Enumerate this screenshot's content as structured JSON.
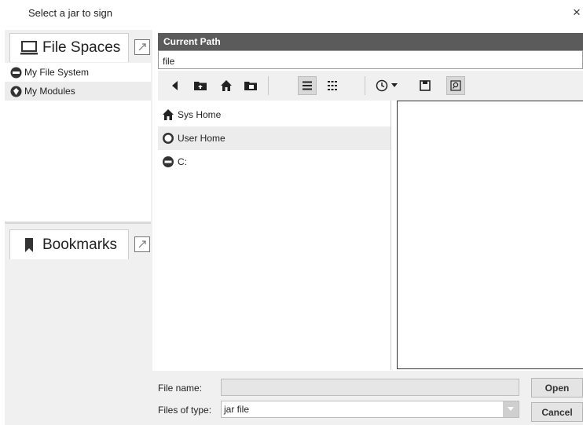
{
  "window": {
    "title": "Select a jar to sign",
    "close_glyph": "×"
  },
  "file_spaces": {
    "label": "File Spaces",
    "items": [
      {
        "label": "My File System",
        "icon": "drive-icon"
      },
      {
        "label": "My Modules",
        "icon": "modules-icon"
      }
    ]
  },
  "bookmarks": {
    "label": "Bookmarks"
  },
  "current_path": {
    "header": "Current Path",
    "value": "file"
  },
  "toolbar": {
    "buttons": [
      "back-icon",
      "folder-up-icon",
      "home-icon",
      "new-folder-icon",
      "list-view-icon",
      "details-view-icon",
      "history-icon",
      "history-dropdown-icon",
      "save-icon",
      "search-icon"
    ]
  },
  "tree": {
    "items": [
      {
        "label": "Sys Home",
        "icon": "home-icon"
      },
      {
        "label": "User Home",
        "icon": "user-home-icon"
      },
      {
        "label": "C:",
        "icon": "drive-icon"
      }
    ]
  },
  "footer": {
    "file_name_label": "File name:",
    "file_name_value": "",
    "files_of_type_label": "Files of type:",
    "files_of_type_value": "jar file",
    "open_label": "Open",
    "cancel_label": "Cancel"
  },
  "colors": {
    "header_bg": "#5b5b5b",
    "selection_bg": "#ececec",
    "panel_bg": "#f0f0f0"
  }
}
